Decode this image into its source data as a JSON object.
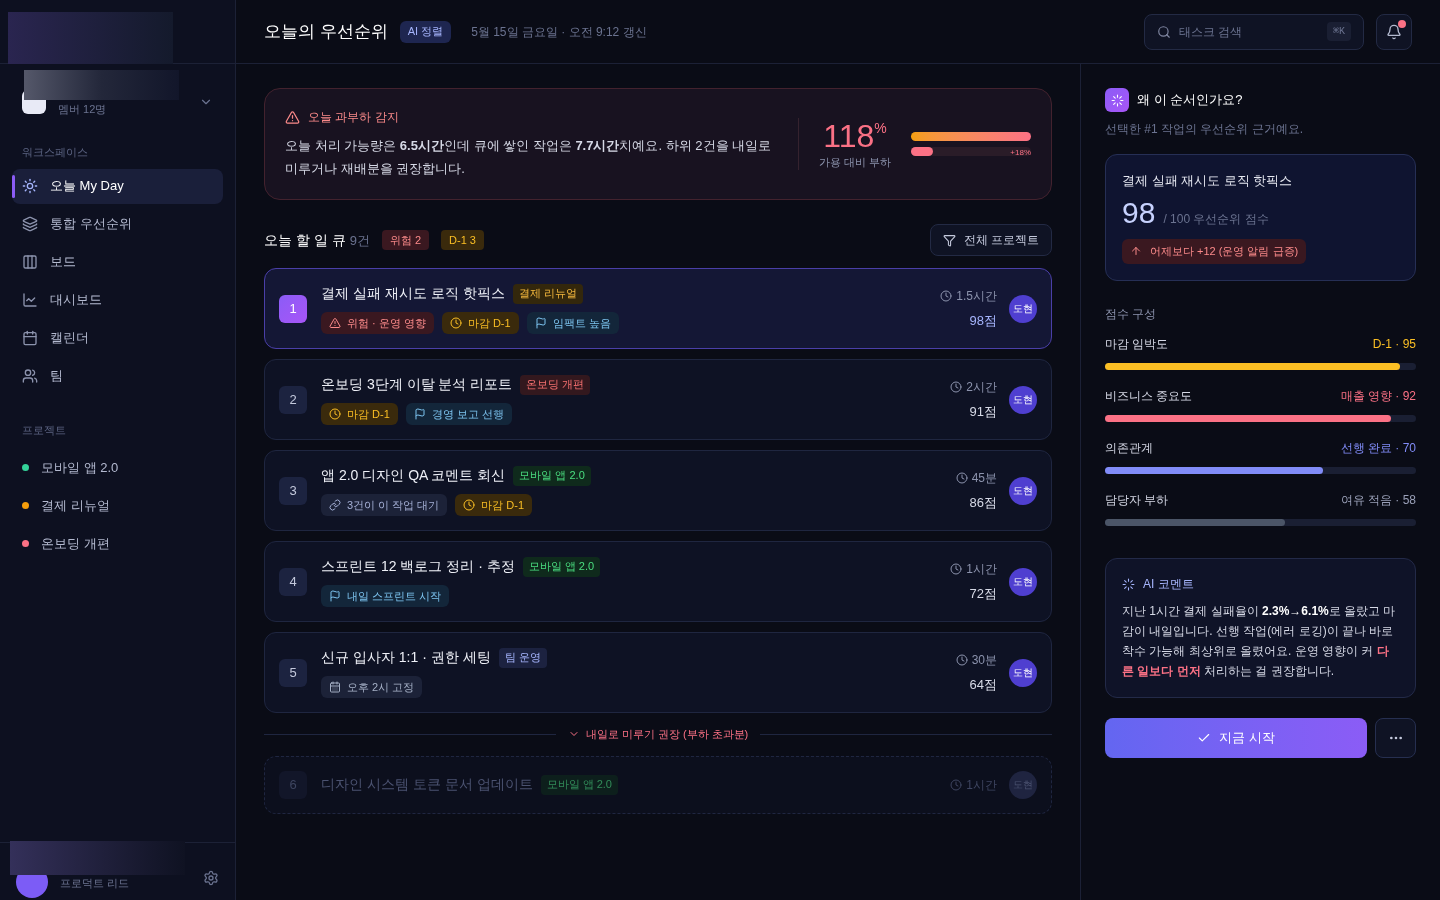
{
  "sidebar": {
    "workspace": {
      "members": "멤버 12명"
    },
    "nav_label": "워크스페이스",
    "nav": [
      {
        "label": "오늘 My Day",
        "selected": true
      },
      {
        "label": "통합 우선순위",
        "selected": false
      },
      {
        "label": "보드",
        "selected": false
      },
      {
        "label": "대시보드",
        "selected": false
      },
      {
        "label": "캘린더",
        "selected": false
      },
      {
        "label": "팀",
        "selected": false
      }
    ],
    "projects_label": "프로젝트",
    "projects": [
      {
        "name": "모바일 앱 2.0",
        "color": "#34d399"
      },
      {
        "name": "결제 리뉴얼",
        "color": "#f59e0b"
      },
      {
        "name": "온보딩 개편",
        "color": "#fb7185"
      }
    ],
    "user": {
      "role": "프로덕트 리드"
    }
  },
  "header": {
    "title": "오늘의 우선순위",
    "badge": "AI 정렬",
    "updated": "5월 15일 금요일 · 오전 9:12 갱신",
    "search": {
      "placeholder": "태스크 검색",
      "shortcut": "⌘K"
    },
    "notifications_unread": true
  },
  "alert": {
    "title": "오늘 과부하 감지",
    "message": "오늘 처리 가능량은 **6.5시간**인데 큐에 쌓인 작업은 **7.7시간**치예요. 하위 2건을 내일로 미루거나 재배분을 권장합니다.",
    "percent": "118",
    "percent_sign": "%",
    "caption": "가용 대비 부하",
    "overflow": {
      "level": 0.18,
      "label": "+18%"
    }
  },
  "queue": {
    "title": "오늘 할 일 큐",
    "count": "9건",
    "badges": [
      {
        "kind": "risk",
        "label": "위험 2"
      },
      {
        "kind": "deadline",
        "label": "D-1 3"
      }
    ],
    "filter": "전체 프로젝트"
  },
  "tasks": [
    {
      "rank": "1",
      "title": "결제 실패 재시도 로직 핫픽스",
      "project": {
        "label": "결제 리뉴얼",
        "kind": "amber"
      },
      "tags": [
        {
          "kind": "risk",
          "label": "위험 · 운영 영향"
        },
        {
          "kind": "deadline",
          "label": "마감 D-1"
        },
        {
          "kind": "flag",
          "label": "임팩트 높음"
        }
      ],
      "duration": "1.5시간",
      "score": "98점",
      "assignee": "도현",
      "selected": true
    },
    {
      "rank": "2",
      "title": "온보딩 3단계 이탈 분석 리포트",
      "project": {
        "label": "온보딩 개편",
        "kind": "rose"
      },
      "tags": [
        {
          "kind": "deadline",
          "label": "마감 D-1"
        },
        {
          "kind": "flag",
          "label": "경영 보고 선행"
        }
      ],
      "duration": "2시간",
      "score": "91점",
      "assignee": "도현",
      "selected": false
    },
    {
      "rank": "3",
      "title": "앱 2.0 디자인 QA 코멘트 회신",
      "project": {
        "label": "모바일 앱 2.0",
        "kind": "green"
      },
      "tags": [
        {
          "kind": "link",
          "label": "3건이 이 작업 대기"
        },
        {
          "kind": "deadline",
          "label": "마감 D-1"
        }
      ],
      "duration": "45분",
      "score": "86점",
      "assignee": "도현",
      "selected": false
    },
    {
      "rank": "4",
      "title": "스프린트 12 백로그 정리 · 추정",
      "project": {
        "label": "모바일 앱 2.0",
        "kind": "green"
      },
      "tags": [
        {
          "kind": "flag",
          "label": "내일 스프린트 시작"
        }
      ],
      "duration": "1시간",
      "score": "72점",
      "assignee": "도현",
      "selected": false
    },
    {
      "rank": "5",
      "title": "신규 입사자 1:1 · 권한 세팅",
      "project": {
        "label": "팀 운영",
        "kind": "indigo"
      },
      "tags": [
        {
          "kind": "calendar",
          "label": "오후 2시 고정"
        }
      ],
      "duration": "30분",
      "score": "64점",
      "assignee": "도현",
      "selected": false
    }
  ],
  "defer_divider": "내일로 미루기 권장 (부하 초과분)",
  "deferred_tasks": [
    {
      "rank": "6",
      "title": "디자인 시스템 토큰 문서 업데이트",
      "project": {
        "label": "모바일 앱 2.0",
        "kind": "green"
      },
      "duration": "1시간",
      "assignee": "도현"
    }
  ],
  "detail": {
    "title": "왜 이 순서인가요?",
    "subtitle": "선택한 #1 작업의 우선순위 근거예요.",
    "card": {
      "title": "결제 실패 재시도 로직 핫픽스",
      "score": "98",
      "score_suffix": "/ 100 우선순위 점수",
      "delta": "어제보다 +12 (운영 알림 급증)"
    },
    "breakdown_title": "점수 구성",
    "factors": [
      {
        "label": "마감 임박도",
        "reading": "D-1 · 95",
        "level": 0.95,
        "color": "#fbbf24"
      },
      {
        "label": "비즈니스 중요도",
        "reading": "매출 영향 · 92",
        "level": 0.92,
        "color": "#fb7185"
      },
      {
        "label": "의존관계",
        "reading": "선행 완료 · 70",
        "level": 0.7,
        "color": "#818cf8"
      },
      {
        "label": "담당자 부하",
        "reading": "여유 적음 · 58",
        "level": 0.58,
        "color": "#4b5567"
      }
    ],
    "ai_comment": {
      "title": "AI 코멘트",
      "parts": [
        {
          "kind": "plain",
          "text": "지난 1시간 결제 실패율이 "
        },
        {
          "kind": "strong",
          "text": "2.3%→6.1%"
        },
        {
          "kind": "plain",
          "text": "로 올랐고 마감이 내일입니다. 선행 작업(에러 로깅)이 끝나 바로 착수 가능해 최상위로 올렸어요. 운영 영향이 커 "
        },
        {
          "kind": "highlight",
          "text": "다른 일보다 먼저"
        },
        {
          "kind": "plain",
          "text": " 처리하는 걸 권장합니다."
        }
      ]
    },
    "primary_action": "지금 시작"
  }
}
